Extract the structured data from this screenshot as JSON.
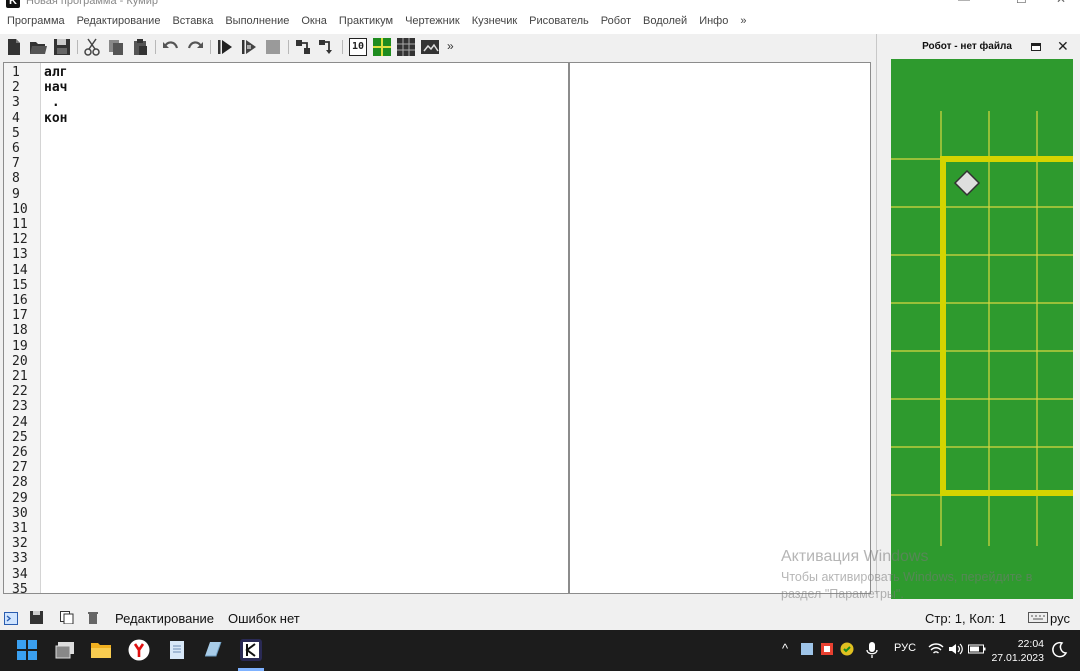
{
  "window": {
    "title": "Новая программа - Кумир",
    "app_icon_letter": "K"
  },
  "menu": [
    "Программа",
    "Редактирование",
    "Вставка",
    "Выполнение",
    "Окна",
    "Практикум",
    "Чертежник",
    "Кузнечик",
    "Рисователь",
    "Робот",
    "Водолей",
    "Инфо",
    "»"
  ],
  "toolbar": {
    "overflow_label": "»",
    "icons": [
      "new-file-icon",
      "open-folder-icon",
      "save-icon",
      "cut-icon",
      "copy-icon",
      "paste-icon",
      "undo-icon",
      "redo-icon",
      "run-icon",
      "step-run-icon",
      "stop-icon",
      "step-over-icon",
      "step-into-icon",
      "pult-icon",
      "robot-grid-icon",
      "field-icon",
      "drawer-icon"
    ],
    "grid_button_label": "10"
  },
  "editor": {
    "line_numbers": [
      "1",
      "2",
      "3",
      "4",
      "5",
      "6",
      "7",
      "8",
      "9",
      "10",
      "11",
      "12",
      "13",
      "14",
      "15",
      "16",
      "17",
      "18",
      "19",
      "20",
      "21",
      "22",
      "23",
      "24",
      "25",
      "26",
      "27",
      "28",
      "29",
      "30",
      "31",
      "32",
      "33",
      "34",
      "35"
    ],
    "code_lines": [
      "алг",
      "нач",
      " .",
      "кон"
    ]
  },
  "robot_panel": {
    "title": "Робот - нет файла",
    "close_label": "✕",
    "colors": {
      "field": "#2e9a2e",
      "grid": "#d8d840",
      "wall": "#d4d400",
      "robot": "#dedede"
    }
  },
  "watermark": {
    "title": "Активация Windows",
    "line2": "Чтобы активировать Windows, перейдите в",
    "line3": "раздел \"Параметры\"."
  },
  "statusbar": {
    "mode": "Редактирование",
    "errors": "Ошибок нет",
    "position": "Стр: 1, Кол: 1",
    "keyboard": "рус"
  },
  "taskbar": {
    "language": "РУС",
    "time": "22:04",
    "date": "27.01.2023"
  }
}
